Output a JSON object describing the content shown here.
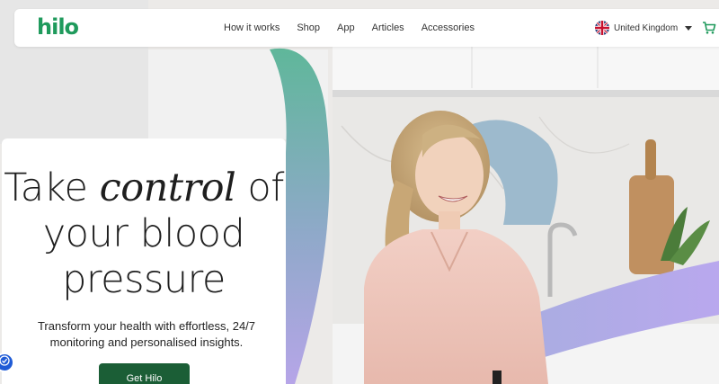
{
  "header": {
    "logo_text": "hilo",
    "nav": [
      "How it works",
      "Shop",
      "App",
      "Articles",
      "Accessories"
    ],
    "locale": "United Kingdom"
  },
  "hero": {
    "title_part1": "Take ",
    "title_emphasis": "control",
    "title_part2": " of your blood pressure",
    "subtitle": "Transform your health with effortless, 24/7 monitoring and personalised insights.",
    "cta_label": "Get Hilo"
  },
  "colors": {
    "brand_green": "#1f9a5c",
    "cta_green": "#1b5e36",
    "accessibility_blue": "#1f5bd6"
  },
  "icons": [
    "uk-flag-icon",
    "chevron-down-icon",
    "cart-icon",
    "accessibility-icon"
  ]
}
